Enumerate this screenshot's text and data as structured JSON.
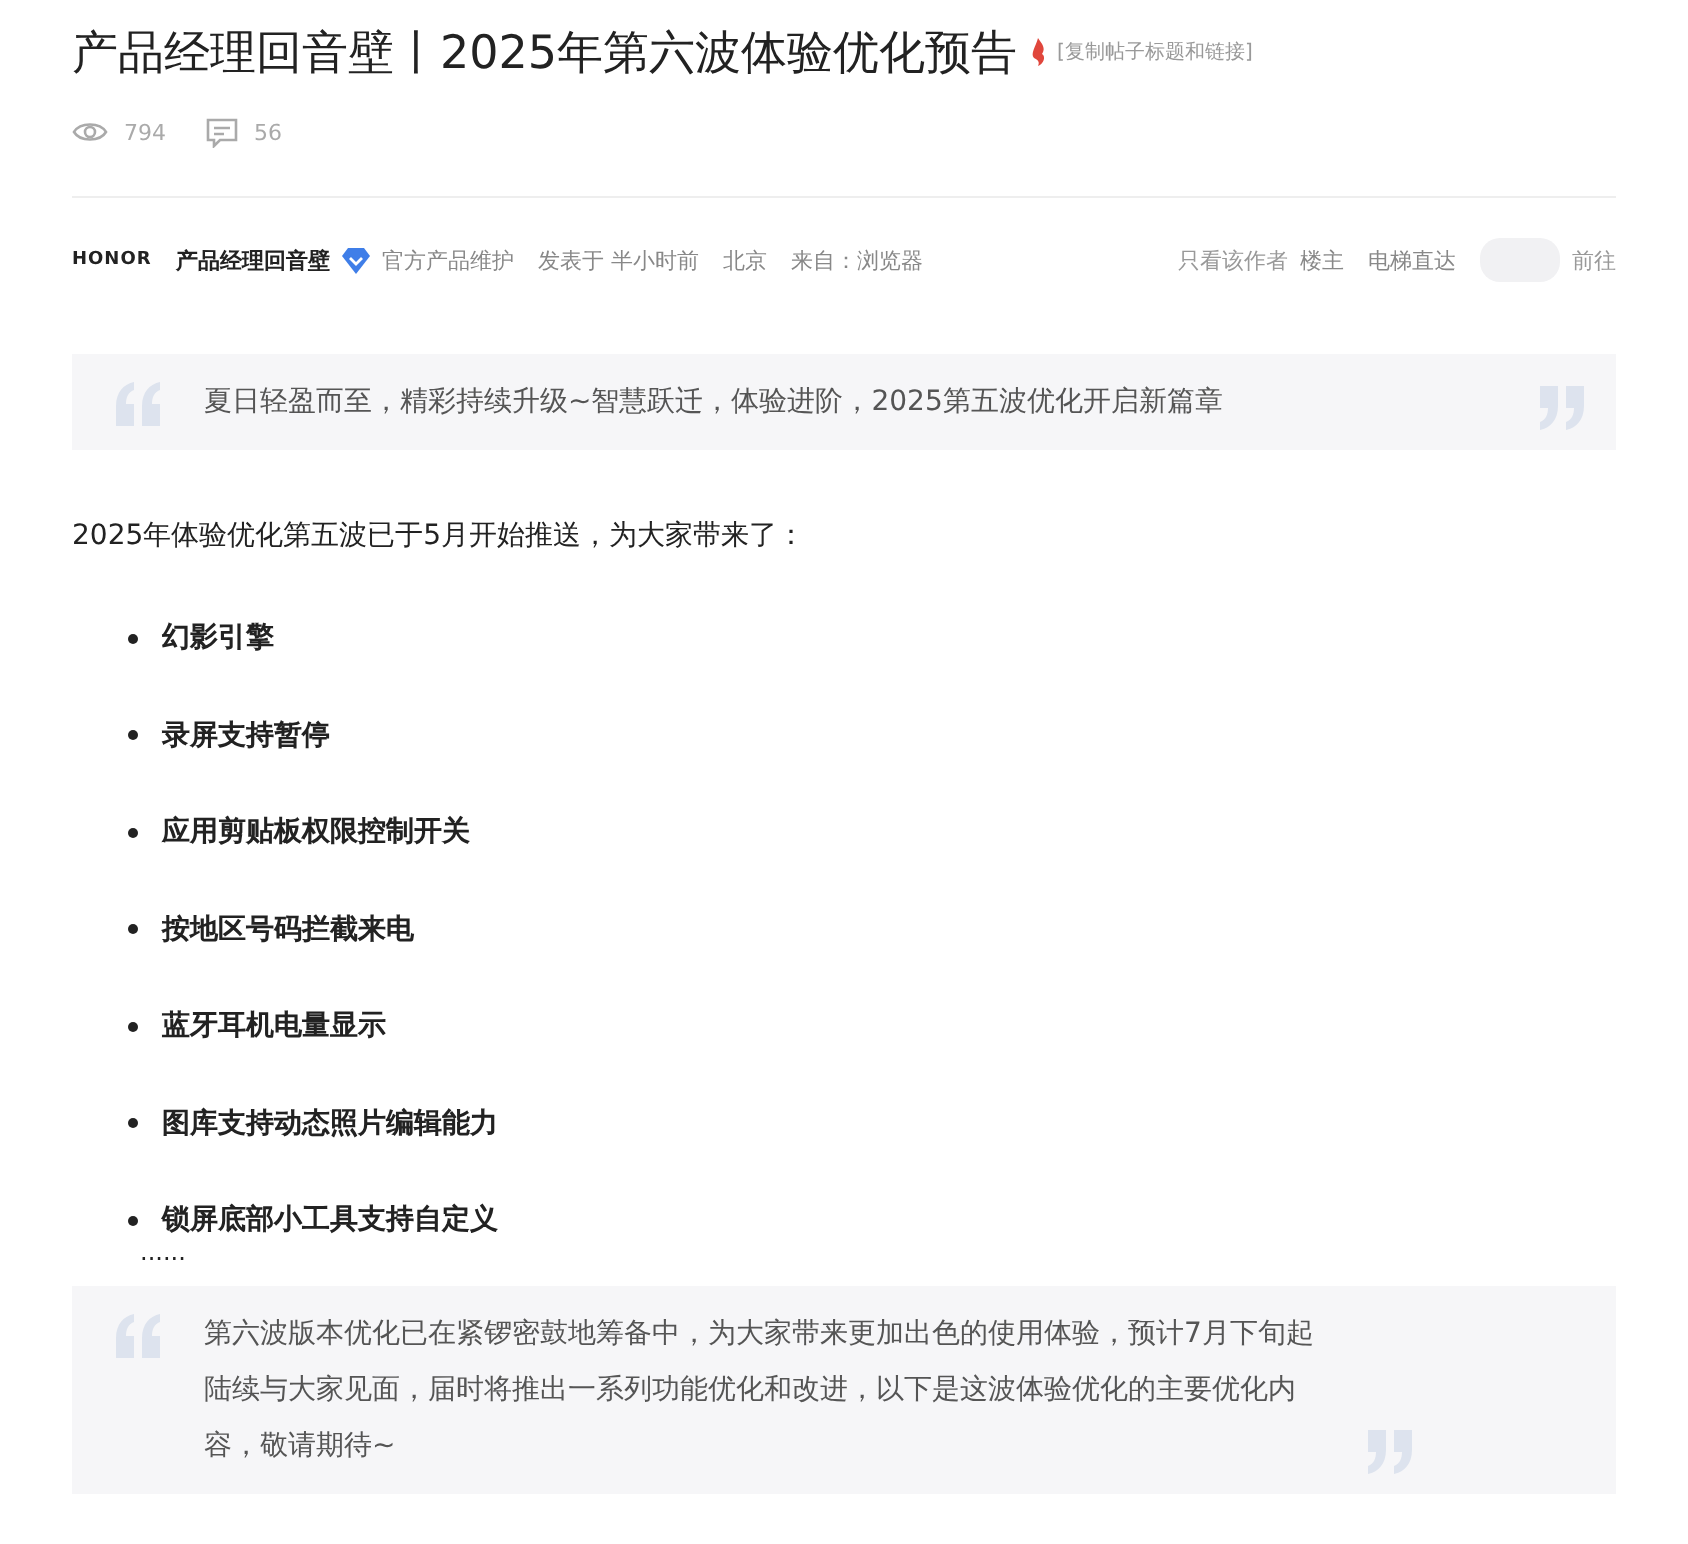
{
  "title": "产品经理回音壁丨2025年第六波体验优化预告",
  "copy_link": "[复制帖子标题和链接]",
  "stats": {
    "views": "794",
    "comments": "56"
  },
  "author_bar": {
    "brand": "HONOR",
    "author": "产品经理回音壁",
    "verified_label": "官方产品维护",
    "posted": "发表于 半小时前",
    "location": "北京",
    "source": "来自：浏览器",
    "only_author": "只看该作者",
    "floor": "楼主",
    "jump_label": "电梯直达",
    "go": "前往"
  },
  "quote_1": "夏日轻盈而至，精彩持续升级~智慧跃迁，体验进阶，2025第五波优化开启新篇章",
  "intro": "2025年体验优化第五波已于5月开始推送，为大家带来了：",
  "features": [
    "幻影引擎",
    "录屏支持暂停",
    "应用剪贴板权限控制开关",
    "按地区号码拦截来电",
    "蓝牙耳机电量显示",
    "图库支持动态照片编辑能力",
    "锁屏底部小工具支持自定义"
  ],
  "ellipsis": "......",
  "quote_2": "第六波版本优化已在紧锣密鼓地筹备中，为大家带来更加出色的使用体验，预计7月下旬起陆续与大家见面，届时将推出一系列功能优化和改进，以下是这波体验优化的主要优化内容，敬请期待~"
}
